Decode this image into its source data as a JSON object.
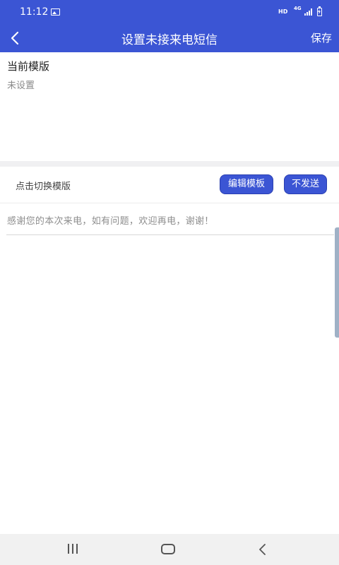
{
  "status_bar": {
    "time": "11:12",
    "image_icon": "image-icon",
    "hd_label": "HD",
    "network_label": "4G",
    "signal_icon": "signal-icon",
    "battery_icon": "battery-charging-icon"
  },
  "app_bar": {
    "back_icon": "back-arrow-icon",
    "title": "设置未接来电短信",
    "save_label": "保存"
  },
  "current_template": {
    "label": "当前模版",
    "value": "未设置"
  },
  "template_actions": {
    "switch_label": "点击切换模版",
    "edit_label": "编辑模板",
    "no_send_label": "不发送"
  },
  "message": {
    "text": "感谢您的本次来电，如有问题，欢迎再电，谢谢！"
  },
  "nav_bar": {
    "recents_icon": "recents-icon",
    "home_icon": "home-icon",
    "back_icon": "back-icon"
  },
  "colors": {
    "primary": "#3b55d4",
    "scroll_handle": "#9fb1c6",
    "nav_bar_bg": "#f1f1f1"
  }
}
